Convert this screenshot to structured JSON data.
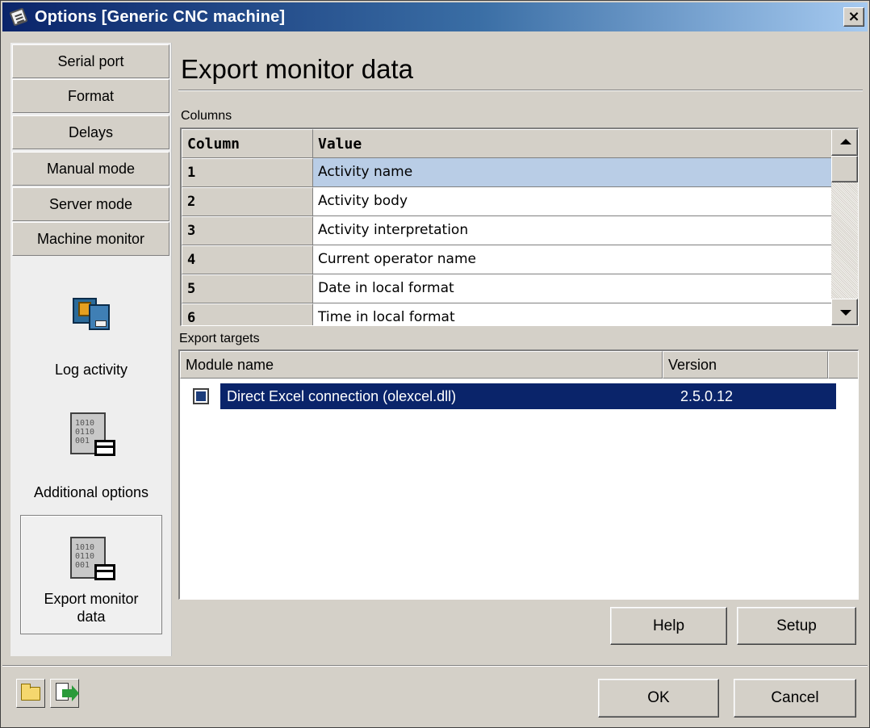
{
  "window": {
    "title": "Options [Generic CNC machine]",
    "close_label": "×"
  },
  "nav": {
    "buttons": [
      "Serial port",
      "Format",
      "Delays",
      "Manual mode",
      "Server mode",
      "Machine monitor"
    ],
    "items": [
      {
        "label": "Log activity",
        "icon": "log-activity-icon"
      },
      {
        "label": "Additional options",
        "icon": "binary-document-icon"
      },
      {
        "label": "Export monitor data",
        "icon": "binary-document-icon",
        "selected": true
      }
    ],
    "binary_glyph": "1010\n0110\n001"
  },
  "page": {
    "title": "Export monitor data"
  },
  "columns": {
    "label": "Columns",
    "headers": [
      "Column",
      "Value"
    ],
    "rows": [
      {
        "column": "1",
        "value": "Activity name",
        "selected": true
      },
      {
        "column": "2",
        "value": "Activity body"
      },
      {
        "column": "3",
        "value": "Activity interpretation"
      },
      {
        "column": "4",
        "value": "Current operator name"
      },
      {
        "column": "5",
        "value": "Date in local format"
      },
      {
        "column": "6",
        "value": "Time in local format"
      }
    ]
  },
  "targets": {
    "label": "Export targets",
    "headers": [
      "Module name",
      "Version"
    ],
    "rows": [
      {
        "module": "Direct Excel connection (olexcel.dll)",
        "version": "2.5.0.12",
        "checked": true
      }
    ]
  },
  "buttons": {
    "help": "Help",
    "setup": "Setup",
    "ok": "OK",
    "cancel": "Cancel"
  },
  "toolbar": {
    "open_icon": "open-folder-icon",
    "export_icon": "export-document-icon"
  },
  "colors": {
    "title_bar": "#0a246a",
    "selection": "#0a246a",
    "grid_selection": "#b9cde6",
    "face": "#d4d0c8"
  }
}
